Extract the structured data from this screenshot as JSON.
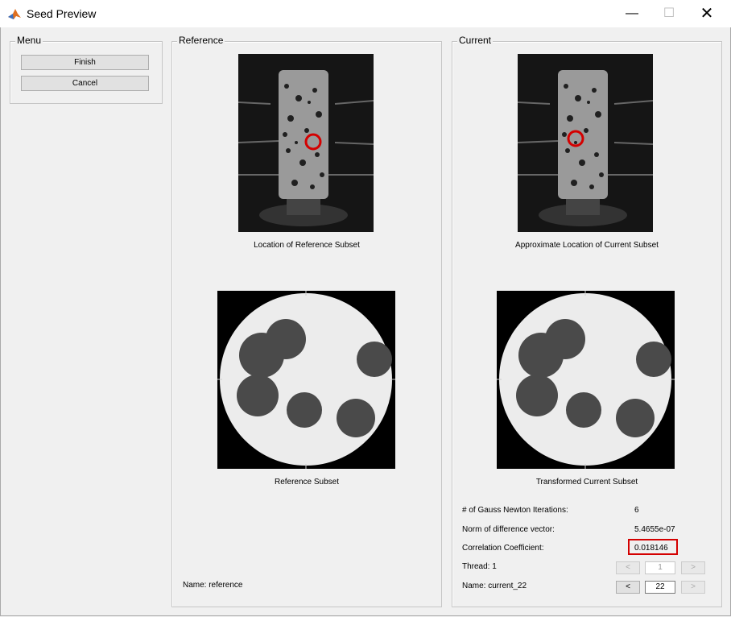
{
  "window": {
    "title": "Seed Preview",
    "controls": {
      "minimize": "—",
      "maximize": "☐",
      "close": "✕"
    }
  },
  "menu": {
    "title": "Menu",
    "finish_label": "Finish",
    "cancel_label": "Cancel"
  },
  "reference": {
    "title": "Reference",
    "location_caption": "Location of Reference Subset",
    "subset_caption": "Reference Subset",
    "name_label": "Name: reference"
  },
  "current": {
    "title": "Current",
    "location_caption": "Approximate Location of Current Subset",
    "subset_caption": "Transformed Current Subset",
    "stats": {
      "iterations_label": "# of Gauss Newton Iterations:",
      "iterations_value": "6",
      "norm_label": "Norm of difference vector:",
      "norm_value": "5.4655e-07",
      "corr_label": "Correlation Coefficient:",
      "corr_value": "0.018146"
    },
    "thread_label": "Thread: 1",
    "thread_value": "1",
    "name_label": "Name: current_22",
    "name_value": "22",
    "prev": "<",
    "next": ">"
  },
  "colors": {
    "highlight": "#d40000",
    "panel_bg": "#f0f0f0"
  }
}
